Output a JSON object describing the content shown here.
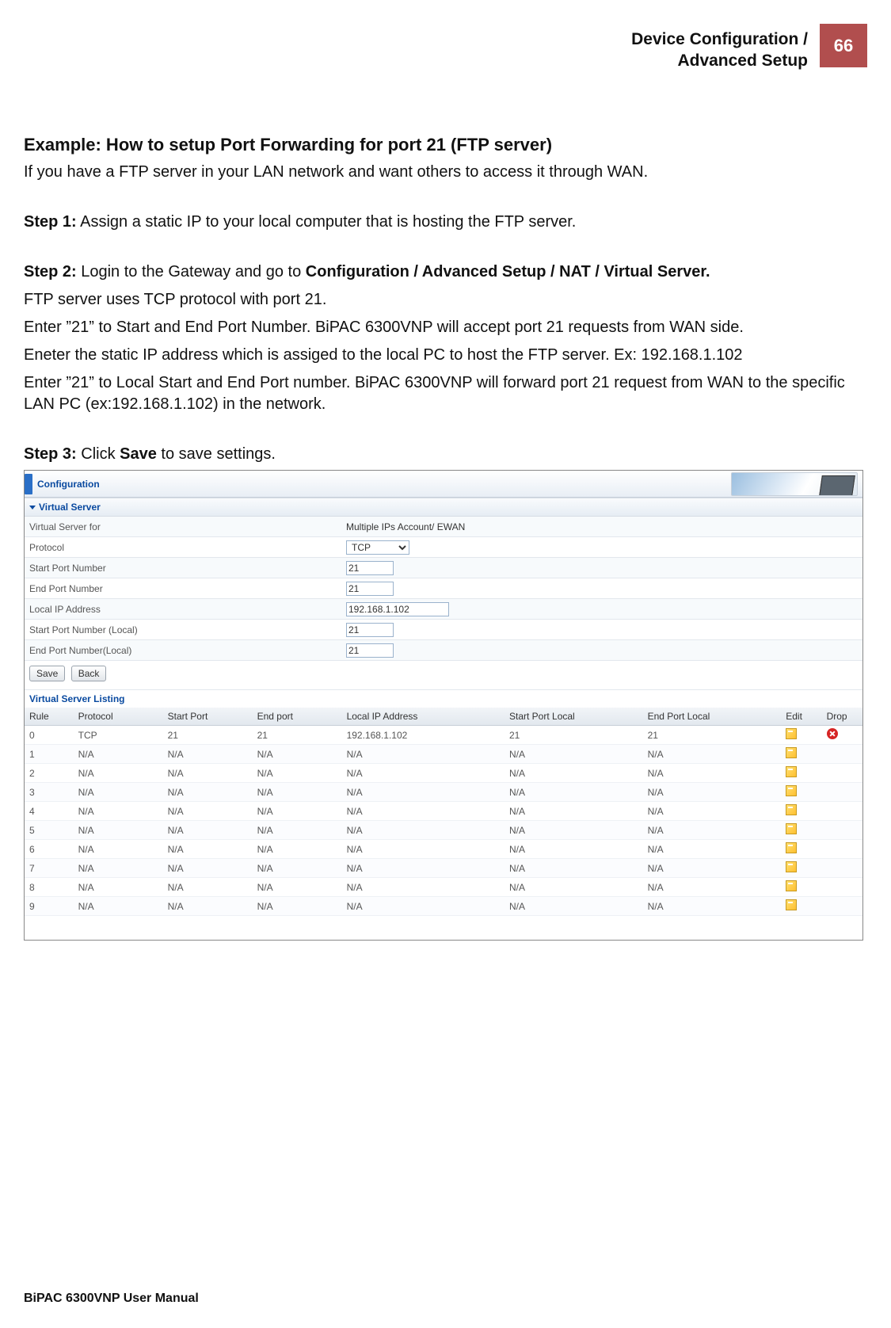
{
  "header": {
    "title": "Device Configuration /\nAdvanced Setup",
    "page_number": "66"
  },
  "body": {
    "heading": "Example: How to setup Port Forwarding for port 21 (FTP server)",
    "intro": "If you have a FTP server in your LAN network and want others to access it through WAN.",
    "step1_label": "Step 1:",
    "step1_text": "  Assign a static IP to your local computer that is hosting the FTP server.",
    "step2_label": "Step 2:",
    "step2_text_a": "  Login to the Gateway and go to ",
    "step2_text_b_bold": "Configuration / Advanced Setup / NAT / Virtual Server.",
    "step2_p1": "FTP server uses TCP protocol with port 21.",
    "step2_p2": "Enter ”21” to Start and End Port Number.  BiPAC 6300VNP will accept port 21 requests from WAN side.",
    "step2_p3": "Eneter the static IP address which is assiged to the local PC to host the FTP server. Ex: 192.168.1.102",
    "step2_p4": "Enter ”21” to Local Start and End Port number. BiPAC 6300VNP will forward port 21 request from WAN to the specific LAN PC (ex:192.168.1.102) in the network.",
    "step3_label": "Step 3:",
    "step3_text_a": " Click ",
    "step3_text_b_bold": "Save",
    "step3_text_c": " to save settings."
  },
  "panel": {
    "tab_label": "Configuration",
    "section_title": "Virtual Server",
    "fields": {
      "vs_for_label": "Virtual Server for",
      "vs_for_value": "Multiple IPs Account/ EWAN",
      "protocol_label": "Protocol",
      "protocol_value": "TCP",
      "start_port_label": "Start Port Number",
      "start_port_value": "21",
      "end_port_label": "End Port Number",
      "end_port_value": "21",
      "local_ip_label": "Local IP Address",
      "local_ip_value": "192.168.1.102",
      "start_port_local_label": "Start Port Number (Local)",
      "start_port_local_value": "21",
      "end_port_local_label": "End Port Number(Local)",
      "end_port_local_value": "21"
    },
    "buttons": {
      "save": "Save",
      "back": "Back"
    },
    "listing_title": "Virtual Server Listing",
    "columns": [
      "Rule",
      "Protocol",
      "Start Port",
      "End port",
      "Local IP Address",
      "Start Port Local",
      "End Port Local",
      "Edit",
      "Drop"
    ],
    "rows": [
      {
        "rule": "0",
        "protocol": "TCP",
        "start": "21",
        "end": "21",
        "ip": "192.168.1.102",
        "start_local": "21",
        "end_local": "21",
        "drop": true
      },
      {
        "rule": "1",
        "protocol": "N/A",
        "start": "N/A",
        "end": "N/A",
        "ip": "N/A",
        "start_local": "N/A",
        "end_local": "N/A",
        "drop": false
      },
      {
        "rule": "2",
        "protocol": "N/A",
        "start": "N/A",
        "end": "N/A",
        "ip": "N/A",
        "start_local": "N/A",
        "end_local": "N/A",
        "drop": false
      },
      {
        "rule": "3",
        "protocol": "N/A",
        "start": "N/A",
        "end": "N/A",
        "ip": "N/A",
        "start_local": "N/A",
        "end_local": "N/A",
        "drop": false
      },
      {
        "rule": "4",
        "protocol": "N/A",
        "start": "N/A",
        "end": "N/A",
        "ip": "N/A",
        "start_local": "N/A",
        "end_local": "N/A",
        "drop": false
      },
      {
        "rule": "5",
        "protocol": "N/A",
        "start": "N/A",
        "end": "N/A",
        "ip": "N/A",
        "start_local": "N/A",
        "end_local": "N/A",
        "drop": false
      },
      {
        "rule": "6",
        "protocol": "N/A",
        "start": "N/A",
        "end": "N/A",
        "ip": "N/A",
        "start_local": "N/A",
        "end_local": "N/A",
        "drop": false
      },
      {
        "rule": "7",
        "protocol": "N/A",
        "start": "N/A",
        "end": "N/A",
        "ip": "N/A",
        "start_local": "N/A",
        "end_local": "N/A",
        "drop": false
      },
      {
        "rule": "8",
        "protocol": "N/A",
        "start": "N/A",
        "end": "N/A",
        "ip": "N/A",
        "start_local": "N/A",
        "end_local": "N/A",
        "drop": false
      },
      {
        "rule": "9",
        "protocol": "N/A",
        "start": "N/A",
        "end": "N/A",
        "ip": "N/A",
        "start_local": "N/A",
        "end_local": "N/A",
        "drop": false
      }
    ]
  },
  "footer": "BiPAC 6300VNP User Manual"
}
